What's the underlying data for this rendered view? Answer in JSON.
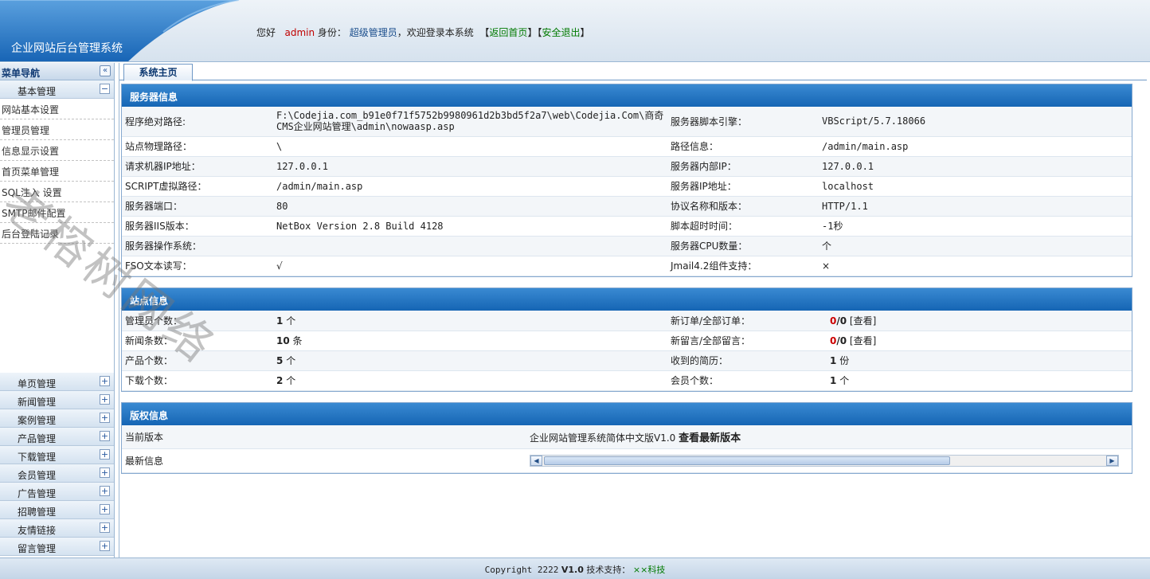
{
  "header": {
    "site_title": "企业网站后台管理系统",
    "greeting_prefix": "您好",
    "username": "admin",
    "role_label": "身份：",
    "role": "超级管理员",
    "welcome": "，欢迎登录本系统",
    "back_home": "返回首页",
    "logout": "安全退出"
  },
  "sidebar": {
    "title": "菜单导航",
    "collapse_icon": "«",
    "open_group": {
      "label": "基本管理",
      "toggle": "−",
      "items": [
        "网站基本设置",
        "管理员管理",
        "信息显示设置",
        "首页菜单管理",
        "SQL注入 设置",
        "SMTP邮件配置",
        "后台登陆记录"
      ]
    },
    "groups": [
      {
        "label": "单页管理",
        "toggle": "+"
      },
      {
        "label": "新闻管理",
        "toggle": "+"
      },
      {
        "label": "案例管理",
        "toggle": "+"
      },
      {
        "label": "产品管理",
        "toggle": "+"
      },
      {
        "label": "下载管理",
        "toggle": "+"
      },
      {
        "label": "会员管理",
        "toggle": "+"
      },
      {
        "label": "广告管理",
        "toggle": "+"
      },
      {
        "label": "招聘管理",
        "toggle": "+"
      },
      {
        "label": "友情链接",
        "toggle": "+"
      },
      {
        "label": "留言管理",
        "toggle": "+"
      }
    ]
  },
  "tabs": {
    "home": "系统主页"
  },
  "server": {
    "title": "服务器信息",
    "rows": [
      [
        "程序绝对路径:",
        "F:\\Codejia.com_b91e0f71f5752b9980961d2b3bd5f2a7\\web\\Codejia.Com\\商奇CMS企业网站管理\\admin\\nowaasp.asp",
        "服务器脚本引擎：",
        "VBScript/5.7.18066"
      ],
      [
        "站点物理路径：",
        "\\",
        "路径信息：",
        "/admin/main.asp"
      ],
      [
        "请求机器IP地址：",
        "127.0.0.1",
        "服务器内部IP：",
        "127.0.0.1"
      ],
      [
        "SCRIPT虚拟路径：",
        "/admin/main.asp",
        "服务器IP地址：",
        "localhost"
      ],
      [
        "服务器端口：",
        "80",
        "协议名称和版本：",
        "HTTP/1.1"
      ],
      [
        "服务器IIS版本：",
        "NetBox Version 2.8 Build 4128",
        "脚本超时时间：",
        "-1秒"
      ],
      [
        "服务器操作系统：",
        "",
        "服务器CPU数量：",
        "个"
      ],
      [
        "FSO文本读写：",
        "√",
        "Jmail4.2组件支持：",
        "×"
      ]
    ]
  },
  "site": {
    "title": "站点信息",
    "admins_label": "管理员个数：",
    "admins_value": "1",
    "admins_unit": "个",
    "news_label": "新闻条数：",
    "news_value": "10",
    "news_unit": "条",
    "products_label": "产品个数：",
    "products_value": "5",
    "products_unit": "个",
    "downloads_label": "下载个数：",
    "downloads_value": "2",
    "downloads_unit": "个",
    "orders_label": "新订单/全部订单：",
    "orders_new": "0",
    "orders_total": "/0",
    "orders_link": "[查看]",
    "messages_label": "新留言/全部留言：",
    "messages_new": "0",
    "messages_total": "/0",
    "messages_link": "[查看]",
    "resumes_label": "收到的简历：",
    "resumes_value": "1",
    "resumes_unit": "份",
    "members_label": "会员个数：",
    "members_value": "1",
    "members_unit": "个"
  },
  "copyright": {
    "title": "版权信息",
    "version_label": "当前版本",
    "version_value": "企业网站管理系统简体中文版V1.0",
    "check_latest": "查看最新版本",
    "latest_label": "最新信息",
    "scroll_left": "◀",
    "scroll_right": "▶"
  },
  "footer": {
    "copyright": "Copyright 2222",
    "version": "V1.0",
    "support_label": "技术支持：",
    "support": "××科技"
  },
  "watermark": "老榕树网络"
}
